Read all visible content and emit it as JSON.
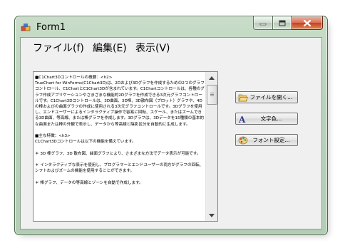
{
  "window": {
    "title": "Form1"
  },
  "menu": [
    {
      "label": "ファイル(f)"
    },
    {
      "label": "編集(E)"
    },
    {
      "label": "表示(V)"
    }
  ],
  "textbox": {
    "content": "■C1Chart3Dコントロールの概要：<h2>\nTrueChart for WinForms(C1Chart3D)は、2Dおよび3Dグラフを作成するための2つのグラフコントロール、C1ChartとC1Chart3Dが含まれています。C1Chartコントロールは、各種のグラフ作成アプリケーションやさまざまな機能的2Dグラフを作成できる3次元グラフコントロールです。C1Chart3Dコントロールは、3D曲面、3D棒、3D散布図（プロット）グラフや、4Dの棒およびの曲面グラフの作成に使用される3次元グラフコントロールです。3Dグラフを使用し、エンドユーザーによるインタラクティブ操作で容易に回転、スケール、またはズームできる3D曲面、等高線、または棒グラフを作成します。3Dグラフは、3Dデータを15種類の基本的な曲面または棒の外観で表示し、データから等高線と陰影区分を自動的に生成します。\n\n■主な特徴：<h3>\nC1Chart3Dコントロールは以下の機能を備えています。\n\n＊ 3D 棒グラフ、3D 散布図、曲面グラフにより、さまざまな方法でデータ表示が可能です。\n\n＊ インタラクティブな表示を使用し、プログラマーとエンドユーザーの両方がグラフの回転、シフトおよびズームの機能を使用することができます。\n\n＊ 棒グラフ、データの等高線とゾーンを自動で作成します。"
  },
  "buttons": [
    {
      "label": "ファイルを開く...",
      "icon": "open-folder-icon"
    },
    {
      "label": "文字色...",
      "icon": "font-color-icon"
    },
    {
      "label": "フォント設定...",
      "icon": "font-settings-icon"
    }
  ]
}
